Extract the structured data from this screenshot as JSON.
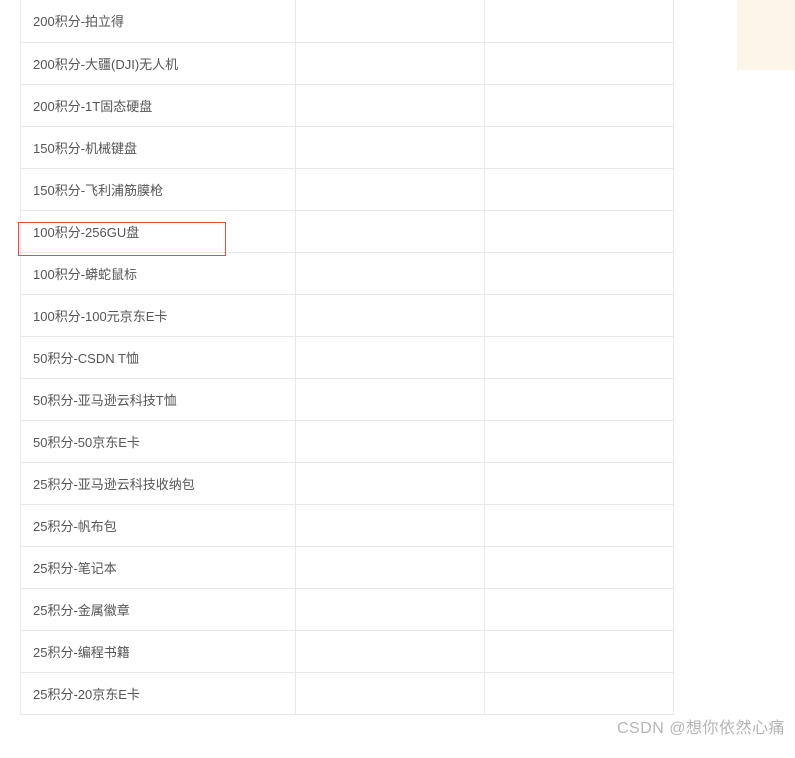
{
  "table": {
    "rows": [
      {
        "label": "200积分-拍立得"
      },
      {
        "label": "200积分-大疆(DJI)无人机"
      },
      {
        "label": "200积分-1T固态硬盘"
      },
      {
        "label": "150积分-机械键盘"
      },
      {
        "label": "150积分-飞利浦筋膜枪"
      },
      {
        "label": "100积分-256GU盘"
      },
      {
        "label": "100积分-蟒蛇鼠标"
      },
      {
        "label": "100积分-100元京东E卡"
      },
      {
        "label": "50积分-CSDN T恤"
      },
      {
        "label": "50积分-亚马逊云科技T恤"
      },
      {
        "label": "50积分-50京东E卡"
      },
      {
        "label": "25积分-亚马逊云科技收纳包"
      },
      {
        "label": "25积分-帆布包"
      },
      {
        "label": "25积分-笔记本"
      },
      {
        "label": "25积分-金属徽章"
      },
      {
        "label": "25积分-编程书籍"
      },
      {
        "label": "25积分-20京东E卡"
      }
    ]
  },
  "highlight_row_index": 5,
  "watermark": "CSDN @想你依然心痛"
}
